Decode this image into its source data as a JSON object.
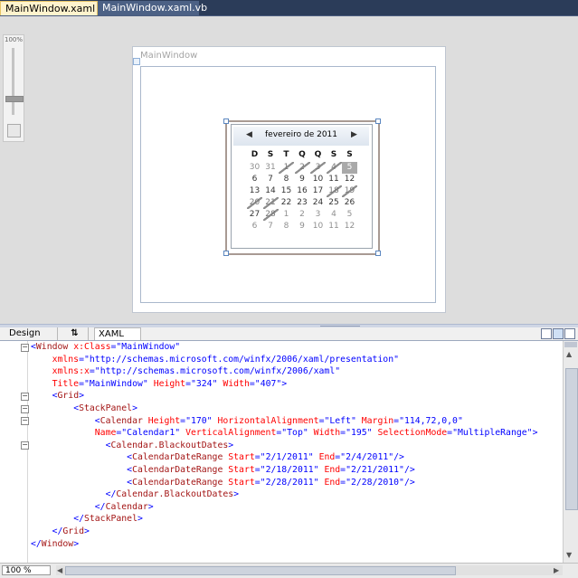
{
  "tabs": [
    {
      "label": "MainWindow.xaml",
      "active": true
    },
    {
      "label": "MainWindow.xaml.vb",
      "active": false
    }
  ],
  "designer": {
    "zoom_label": "100%",
    "window_title": "MainWindow",
    "calendar": {
      "month_title": "fevereiro de 2011",
      "prev_arrow": "◀",
      "next_arrow": "▶",
      "day_headers": [
        "D",
        "S",
        "T",
        "Q",
        "Q",
        "S",
        "S"
      ],
      "weeks": [
        [
          "30",
          "31",
          "1",
          "2",
          "3",
          "4",
          "5"
        ],
        [
          "6",
          "7",
          "8",
          "9",
          "10",
          "11",
          "12"
        ],
        [
          "13",
          "14",
          "15",
          "16",
          "17",
          "18",
          "19"
        ],
        [
          "20",
          "21",
          "22",
          "23",
          "24",
          "25",
          "26"
        ],
        [
          "27",
          "28",
          "1",
          "2",
          "3",
          "4",
          "5"
        ],
        [
          "6",
          "7",
          "8",
          "9",
          "10",
          "11",
          "12"
        ]
      ]
    }
  },
  "view_tabs": {
    "design": "Design",
    "swap": "⇅",
    "xaml": "XAML"
  },
  "code_lines": [
    "<Window x:Class=\"MainWindow\"",
    "    xmlns=\"http://schemas.microsoft.com/winfx/2006/xaml/presentation\"",
    "    xmlns:x=\"http://schemas.microsoft.com/winfx/2006/xaml\"",
    "    Title=\"MainWindow\" Height=\"324\" Width=\"407\">",
    "    <Grid>",
    "        <StackPanel>",
    "            <Calendar Height=\"170\" HorizontalAlignment=\"Left\" Margin=\"114,72,0,0\"",
    "            Name=\"Calendar1\" VerticalAlignment=\"Top\" Width=\"195\" SelectionMode=\"MultipleRange\">",
    "              <Calendar.BlackoutDates>",
    "                  <CalendarDateRange Start=\"2/1/2011\" End=\"2/4/2011\"/>",
    "                  <CalendarDateRange Start=\"2/18/2011\" End=\"2/21/2011\"/>",
    "                  <CalendarDateRange Start=\"2/28/2011\" End=\"2/28/2010\"/>",
    "              </Calendar.BlackoutDates>",
    "            </Calendar>",
    "        </StackPanel>",
    "    </Grid>",
    "</Window>"
  ],
  "status": {
    "zoom": "100 %"
  }
}
